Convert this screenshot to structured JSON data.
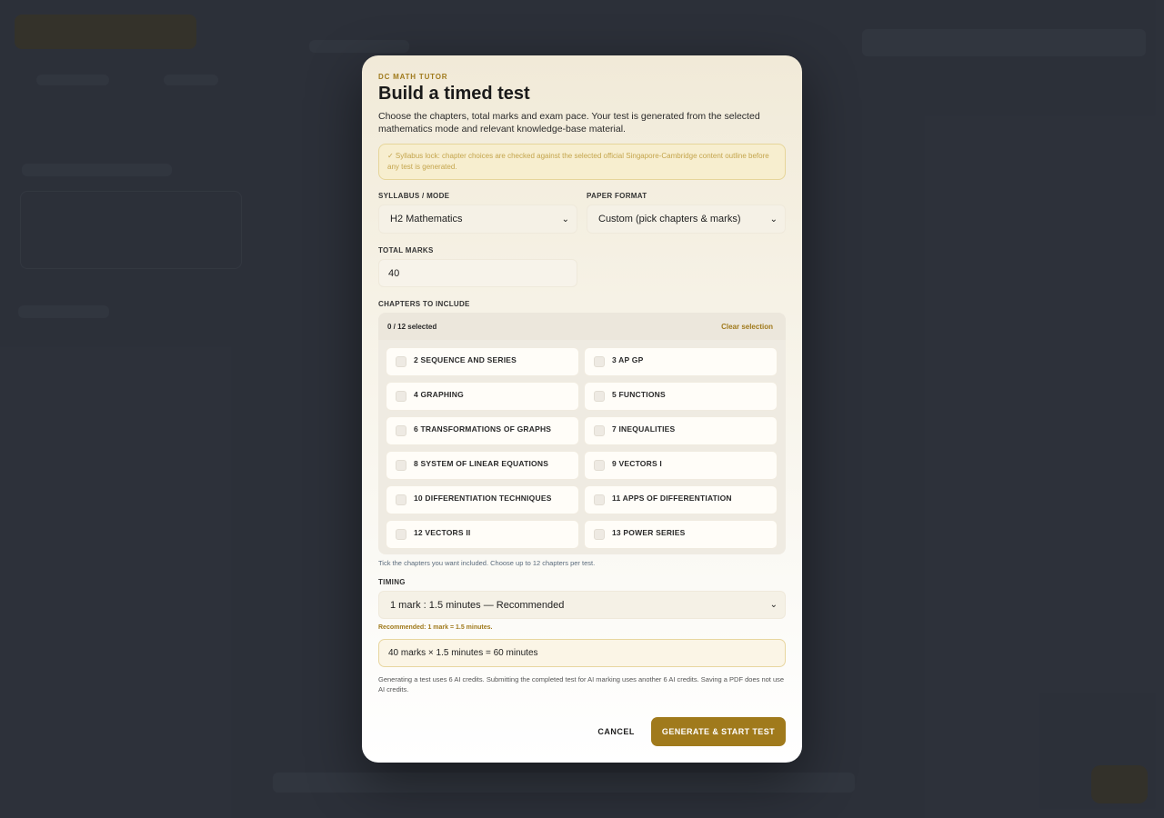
{
  "modal": {
    "eyebrow": "DC MATH TUTOR",
    "title": "Build a timed test",
    "description": "Choose the chapters, total marks and exam pace. Your test is generated from the selected mathematics mode and relevant knowledge-base material.",
    "notice": "✓ Syllabus lock: chapter choices are checked against the selected official Singapore-Cambridge content outline before any test is generated."
  },
  "syllabus": {
    "label": "SYLLABUS / MODE",
    "value": "H2 Mathematics"
  },
  "paper_format": {
    "label": "PAPER FORMAT",
    "value": "Custom (pick chapters & marks)"
  },
  "total_marks": {
    "label": "TOTAL MARKS",
    "value": "40"
  },
  "chapters": {
    "label": "CHAPTERS TO INCLUDE",
    "count": "0 / 12 selected",
    "clear": "Clear selection",
    "items": [
      "2 SEQUENCE AND SERIES",
      "3 AP GP",
      "4 GRAPHING",
      "5 FUNCTIONS",
      "6 TRANSFORMATIONS OF GRAPHS",
      "7 INEQUALITIES",
      "8 SYSTEM OF LINEAR EQUATIONS",
      "9 VECTORS I",
      "10 DIFFERENTIATION TECHNIQUES",
      "11 APPS OF DIFFERENTIATION",
      "12 VECTORS II",
      "13 POWER SERIES"
    ],
    "hint": "Tick the chapters you want included. Choose up to 12 chapters per test."
  },
  "timing": {
    "label": "TIMING",
    "value": "1 mark : 1.5 minutes — Recommended",
    "recommended": "Recommended: 1 mark = 1.5 minutes.",
    "calculation": "40 marks × 1.5 minutes = 60 minutes"
  },
  "footnote": "Generating a test uses 6 AI credits. Submitting the completed test for AI marking uses another 6 AI credits. Saving a PDF does not use AI credits.",
  "actions": {
    "cancel": "CANCEL",
    "primary": "GENERATE & START TEST"
  },
  "colors": {
    "accent": "#a07a1c",
    "backdrop": "#2b3039"
  }
}
